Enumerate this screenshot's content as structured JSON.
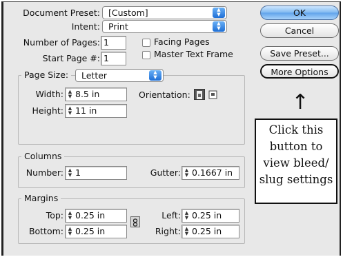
{
  "document_preset": {
    "label": "Document Preset:",
    "value": "[Custom]"
  },
  "intent": {
    "label": "Intent:",
    "value": "Print"
  },
  "number_of_pages": {
    "label": "Number of Pages:",
    "value": "1"
  },
  "start_page": {
    "label": "Start Page #:",
    "value": "1"
  },
  "facing_pages": {
    "label": "Facing Pages",
    "checked": false
  },
  "master_text_frame": {
    "label": "Master Text Frame",
    "checked": false
  },
  "page_size": {
    "legend": "Page Size:",
    "value": "Letter",
    "width_label": "Width:",
    "width_value": "8.5 in",
    "height_label": "Height:",
    "height_value": "11 in",
    "orientation_label": "Orientation:",
    "orientation_selected": "portrait"
  },
  "columns": {
    "legend": "Columns",
    "number_label": "Number:",
    "number_value": "1",
    "gutter_label": "Gutter:",
    "gutter_value": "0.1667 in"
  },
  "margins": {
    "legend": "Margins",
    "top_label": "Top:",
    "top_value": "0.25 in",
    "bottom_label": "Bottom:",
    "bottom_value": "0.25 in",
    "left_label": "Left:",
    "left_value": "0.25 in",
    "right_label": "Right:",
    "right_value": "0.25 in"
  },
  "buttons": {
    "ok": "OK",
    "cancel": "Cancel",
    "save_preset": "Save Preset...",
    "more_options": "More Options"
  },
  "annotation": {
    "arrow": "↑",
    "text": "Click this\nbutton to\nview bleed/\nslug settings"
  },
  "colors": {
    "ok_button": "#7fb8f0",
    "select_arrows": "#1f6fd6",
    "dialog_bg": "#e8e8e8"
  },
  "icons": [
    "stepper-arrows-icon",
    "portrait-orientation-icon",
    "landscape-orientation-icon",
    "chain-link-icon",
    "dropdown-arrows-icon"
  ]
}
